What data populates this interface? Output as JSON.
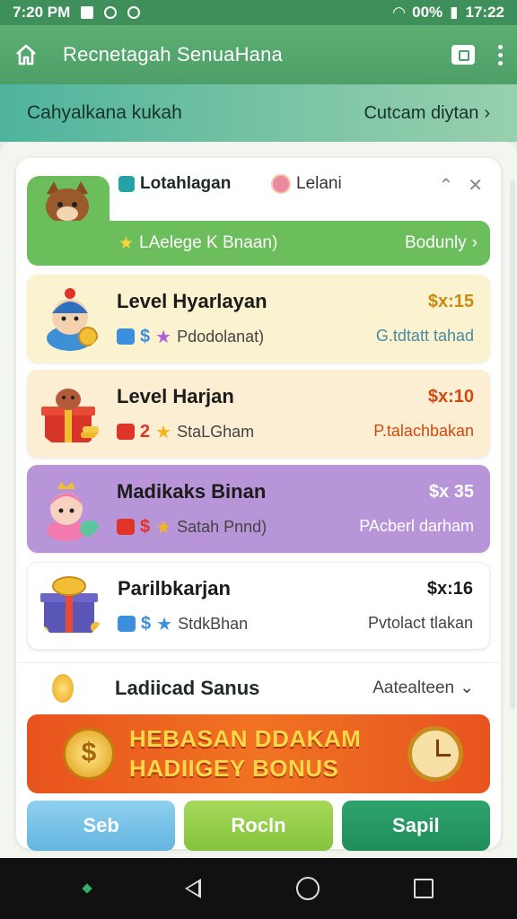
{
  "status_bar": {
    "time_left": "7:20 PM",
    "battery": "00%",
    "time_right": "17:22"
  },
  "app_bar": {
    "title": "Recnetagah SenuaHana",
    "home_icon": "home-icon",
    "action_icon": "card-icon",
    "menu_icon": "more-vert-icon"
  },
  "sub_bar": {
    "label": "Cahyalkana kukah",
    "link": "Cutcam diytan"
  },
  "tabs": [
    {
      "label": "Lotahlagan",
      "icon": "gift-box-icon"
    },
    {
      "label": "Lelani",
      "icon": "avatar-icon"
    }
  ],
  "green_banner": {
    "label": "LAelege K Bnaan)",
    "action": "Bodunly"
  },
  "levels": [
    {
      "name": "Level Hyarlayan",
      "chip_text": "$",
      "status": "Pdodolanat)",
      "price": "$x:15",
      "note": "G.tdtatt tahad",
      "price_color": "#c98a0e",
      "note_color": "#4a8aa0",
      "chip_color": "#3b8fdc",
      "star_icon": "purple-star-icon",
      "star_color": "#b25fd6"
    },
    {
      "name": "Level Harjan",
      "chip_text": "2",
      "status": "StaLGham",
      "price": "$x:10",
      "note": "P.talachbakan",
      "price_color": "#d24a10",
      "note_color": "#d24a10",
      "chip_color": "#e0332a",
      "star_icon": "gold-star-icon",
      "star_color": "#f3b71c"
    },
    {
      "name": "Madikaks Binan",
      "chip_text": "$",
      "status": "Satah Pnnd)",
      "price": "$x 35",
      "note": "PAcberl darham",
      "price_color": "#ffffff",
      "note_color": "#ffffff",
      "chip_color": "#e0332a",
      "star_icon": "gold-star-icon",
      "star_color": "#f3b71c"
    },
    {
      "name": "Parilbkarjan",
      "chip_text": "$",
      "status": "StdkBhan",
      "price": "$x:16",
      "note": "Pvtolact tlakan",
      "price_color": "#1b1b1b",
      "note_color": "#444444",
      "chip_color": "#3b8fdc",
      "star_icon": "blue-star-icon",
      "star_color": "#3b8fdc"
    }
  ],
  "bonus": {
    "title": "Ladiicad Sanus",
    "more": "Aatealteen",
    "promo_line1": "HEBASAN DDAKAM",
    "promo_line2": "HADIIGEY BONUS"
  },
  "buttons": [
    {
      "label": "Seb"
    },
    {
      "label": "Rocln"
    },
    {
      "label": "Sapil"
    }
  ]
}
